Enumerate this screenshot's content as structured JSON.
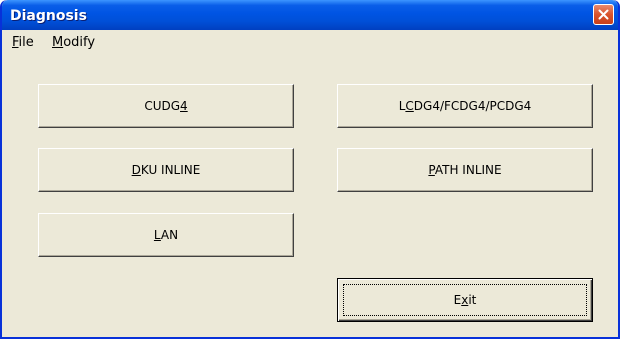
{
  "window": {
    "title": "Diagnosis"
  },
  "menu": [
    {
      "pre": "",
      "u": "F",
      "post": "ile"
    },
    {
      "pre": "",
      "u": "M",
      "post": "odify"
    }
  ],
  "buttons": {
    "cudg4": {
      "pre": "CUDG",
      "u": "4",
      "post": ""
    },
    "lcdg4": {
      "pre": "L",
      "u": "C",
      "post": "DG4/FCDG4/PCDG4"
    },
    "dku_inline": {
      "pre": "",
      "u": "D",
      "post": "KU INLINE"
    },
    "path_inline": {
      "pre": "",
      "u": "P",
      "post": "ATH INLINE"
    },
    "lan": {
      "pre": "",
      "u": "L",
      "post": "AN"
    },
    "exit": {
      "pre": "E",
      "u": "x",
      "post": "it"
    }
  },
  "colors": {
    "title_bar": "#0054e3",
    "window_face": "#ece9d8",
    "close_button": "#d9532c"
  }
}
